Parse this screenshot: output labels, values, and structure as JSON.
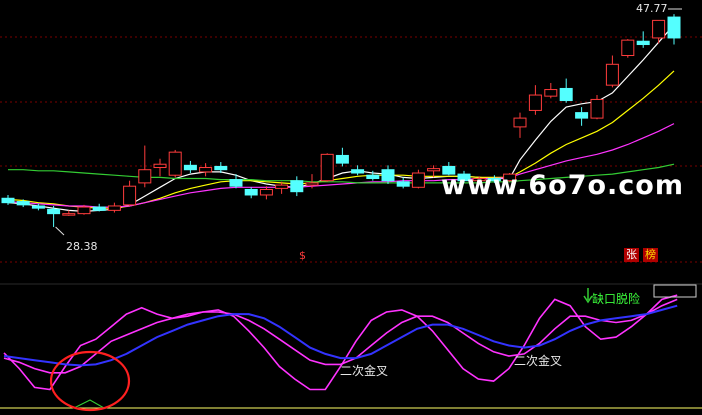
{
  "watermark": "www.6o7o.com",
  "price_labels": {
    "high": "47.77",
    "low": "28.38"
  },
  "tags": {
    "dollar": "$",
    "zhang": "张",
    "bang": "榜"
  },
  "annotations": {
    "cross1": "二次金叉",
    "cross2": "二次金叉",
    "gap": "缺口脱险"
  },
  "colors": {
    "background": "#000000",
    "up": "#ff3c3c",
    "down": "#54ffff",
    "ma_white": "#ffffff",
    "ma_yellow": "#ffff00",
    "ma_magenta": "#ff33ff",
    "ma_green": "#33cc33",
    "grid": "#7a0000",
    "osc_magenta": "#ff33ff",
    "osc_blue": "#3333ff",
    "circle": "#ff2020",
    "ref_line": "#ffff66"
  },
  "chart_data": [
    {
      "type": "candlestick",
      "title": "",
      "x": [
        1,
        2,
        3,
        4,
        5,
        6,
        7,
        8,
        9,
        10,
        11,
        12,
        13,
        14,
        15,
        16,
        17,
        18,
        19,
        20,
        21,
        22,
        23,
        24,
        25,
        26,
        27,
        28,
        29,
        30,
        31,
        32,
        33,
        34
      ],
      "ohlc": [
        [
          31.0,
          31.3,
          30.4,
          30.6
        ],
        [
          30.7,
          30.9,
          30.2,
          30.4
        ],
        [
          30.3,
          30.5,
          29.9,
          30.1
        ],
        [
          30.0,
          30.3,
          28.38,
          29.6
        ],
        [
          29.6,
          29.9,
          29.4,
          29.6
        ],
        [
          29.6,
          30.4,
          29.5,
          30.2
        ],
        [
          30.2,
          30.5,
          29.8,
          29.9
        ],
        [
          29.9,
          30.6,
          29.7,
          30.3
        ],
        [
          30.4,
          32.6,
          30.3,
          32.1
        ],
        [
          32.4,
          35.8,
          32.0,
          33.6
        ],
        [
          33.8,
          34.6,
          33.0,
          34.1
        ],
        [
          33.1,
          35.4,
          32.9,
          35.2
        ],
        [
          34.0,
          34.4,
          33.3,
          33.6
        ],
        [
          33.4,
          34.2,
          33.0,
          33.8
        ],
        [
          33.9,
          34.3,
          33.3,
          33.6
        ],
        [
          32.7,
          33.2,
          31.9,
          32.1
        ],
        [
          31.8,
          32.0,
          31.0,
          31.3
        ],
        [
          31.3,
          32.1,
          30.9,
          31.8
        ],
        [
          31.9,
          32.5,
          31.4,
          32.2
        ],
        [
          32.6,
          33.0,
          31.2,
          31.6
        ],
        [
          32.2,
          33.2,
          31.9,
          32.4
        ],
        [
          32.6,
          35.1,
          32.5,
          35.0
        ],
        [
          34.9,
          35.6,
          33.9,
          34.2
        ],
        [
          33.6,
          34.0,
          33.1,
          33.3
        ],
        [
          33.1,
          33.5,
          32.6,
          32.8
        ],
        [
          33.6,
          34.0,
          32.3,
          32.6
        ],
        [
          32.5,
          32.9,
          31.9,
          32.1
        ],
        [
          32.0,
          33.6,
          31.9,
          33.3
        ],
        [
          33.5,
          34.0,
          32.9,
          33.7
        ],
        [
          33.9,
          34.3,
          33.1,
          33.2
        ],
        [
          33.2,
          33.5,
          32.4,
          32.6
        ],
        [
          32.6,
          33.0,
          32.3,
          32.8
        ],
        [
          32.8,
          33.1,
          32.4,
          32.6
        ],
        [
          32.6,
          33.3,
          32.5,
          33.2
        ]
      ],
      "ohlc_late": [
        [
          37.5,
          38.8,
          36.5,
          38.3
        ],
        [
          39.0,
          41.3,
          38.6,
          40.4
        ],
        [
          40.3,
          41.5,
          40.1,
          40.9
        ],
        [
          41.0,
          41.9,
          39.7,
          39.9
        ],
        [
          38.8,
          39.3,
          37.6,
          38.3
        ],
        [
          38.3,
          40.4,
          38.2,
          40.0
        ],
        [
          41.3,
          44.0,
          41.1,
          43.2
        ],
        [
          44.0,
          45.5,
          43.8,
          45.4
        ],
        [
          45.3,
          46.2,
          44.7,
          45.0
        ],
        [
          45.6,
          47.2,
          45.1,
          47.2
        ],
        [
          47.5,
          47.77,
          45.0,
          45.6
        ]
      ],
      "ma_lines": [
        {
          "name": "",
          "color": "ma_white",
          "values": [
            30.6,
            30.5,
            30.3,
            30.1,
            29.9,
            29.8,
            29.9,
            30.0,
            30.4,
            31.2,
            32.0,
            32.8,
            33.2,
            33.4,
            33.4,
            33.1,
            32.6,
            32.3,
            32.1,
            32.0,
            32.3,
            32.8,
            33.3,
            33.5,
            33.3,
            33.2,
            32.9,
            32.8,
            32.9,
            33.0,
            33.0,
            32.9,
            32.8,
            32.8,
            34.5,
            36.3,
            38.0,
            39.3,
            39.6,
            39.8,
            40.6,
            42.1,
            43.6,
            45.2,
            46.8
          ]
        },
        {
          "name": "",
          "color": "ma_yellow",
          "values": [
            30.9,
            30.8,
            30.6,
            30.5,
            30.3,
            30.2,
            30.1,
            30.1,
            30.3,
            30.6,
            31.0,
            31.5,
            31.9,
            32.2,
            32.5,
            32.6,
            32.6,
            32.5,
            32.4,
            32.3,
            32.4,
            32.6,
            32.8,
            33.0,
            33.1,
            33.1,
            33.1,
            33.0,
            33.0,
            33.0,
            33.0,
            32.9,
            32.9,
            32.9,
            33.4,
            34.2,
            35.1,
            35.9,
            36.5,
            37.1,
            37.9,
            39.0,
            40.1,
            41.3,
            42.6
          ]
        },
        {
          "name": "",
          "color": "ma_magenta",
          "values": [
            30.7,
            30.6,
            30.5,
            30.4,
            30.3,
            30.3,
            30.2,
            30.2,
            30.3,
            30.6,
            30.9,
            31.2,
            31.5,
            31.7,
            31.9,
            32.0,
            32.0,
            32.0,
            32.0,
            32.0,
            32.1,
            32.2,
            32.3,
            32.4,
            32.5,
            32.5,
            32.6,
            32.6,
            32.6,
            32.7,
            32.7,
            32.8,
            32.8,
            32.9,
            33.2,
            33.6,
            34.0,
            34.4,
            34.7,
            35.0,
            35.4,
            35.9,
            36.5,
            37.1,
            37.8
          ]
        },
        {
          "name": "",
          "color": "ma_green",
          "values": [
            33.6,
            33.6,
            33.5,
            33.5,
            33.4,
            33.3,
            33.2,
            33.1,
            33.0,
            32.9,
            32.9,
            32.8,
            32.8,
            32.8,
            32.7,
            32.7,
            32.7,
            32.6,
            32.6,
            32.6,
            32.5,
            32.5,
            32.5,
            32.4,
            32.4,
            32.4,
            32.4,
            32.4,
            32.4,
            32.4,
            32.4,
            32.4,
            32.5,
            32.5,
            32.6,
            32.7,
            32.8,
            32.9,
            33.0,
            33.1,
            33.2,
            33.4,
            33.6,
            33.8,
            34.1
          ]
        }
      ],
      "y_range": [
        27.2,
        48.6
      ]
    },
    {
      "type": "line",
      "title": "",
      "x": [
        1,
        2,
        3,
        4,
        5,
        6,
        7,
        8,
        9,
        10,
        11,
        12,
        13,
        14,
        15,
        16,
        17,
        18,
        19,
        20,
        21,
        22,
        23,
        24,
        25,
        26,
        27,
        28,
        29,
        30,
        31,
        32,
        33,
        34,
        35,
        36,
        37,
        38,
        39,
        40,
        41,
        42,
        43,
        44,
        45
      ],
      "series": [
        {
          "name": "",
          "color": "osc_magenta",
          "values": [
            45,
            30,
            12,
            10,
            32,
            52,
            58,
            70,
            82,
            88,
            82,
            78,
            80,
            84,
            86,
            80,
            66,
            50,
            32,
            20,
            10,
            10,
            32,
            56,
            76,
            84,
            86,
            80,
            66,
            48,
            30,
            20,
            18,
            30,
            52,
            78,
            96,
            90,
            70,
            58,
            60,
            70,
            82,
            96,
            100
          ]
        },
        {
          "name": "",
          "color": "osc_magenta",
          "values": [
            40,
            36,
            30,
            26,
            26,
            32,
            44,
            56,
            62,
            68,
            74,
            78,
            82,
            84,
            84,
            82,
            76,
            68,
            58,
            48,
            38,
            34,
            34,
            40,
            52,
            64,
            74,
            80,
            80,
            74,
            64,
            54,
            46,
            42,
            44,
            54,
            68,
            80,
            80,
            76,
            74,
            76,
            82,
            90,
            96
          ]
        },
        {
          "name": "",
          "color": "osc_blue",
          "values": [
            42,
            40,
            38,
            36,
            34,
            33,
            34,
            38,
            44,
            52,
            60,
            66,
            72,
            76,
            80,
            82,
            82,
            78,
            70,
            60,
            50,
            44,
            40,
            40,
            44,
            52,
            60,
            68,
            72,
            72,
            68,
            62,
            56,
            52,
            50,
            52,
            58,
            66,
            72,
            76,
            78,
            80,
            82,
            86,
            90
          ]
        }
      ],
      "reference_line": {
        "color": "ref_line",
        "value": 0
      },
      "y_range": [
        0,
        105
      ]
    }
  ]
}
